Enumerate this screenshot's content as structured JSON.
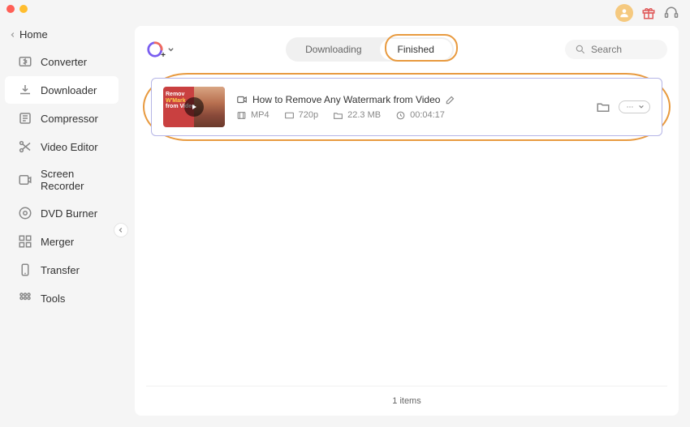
{
  "sidebar": {
    "home": "Home",
    "items": [
      {
        "label": "Converter",
        "icon": "converter"
      },
      {
        "label": "Downloader",
        "icon": "downloader",
        "active": true
      },
      {
        "label": "Compressor",
        "icon": "compressor"
      },
      {
        "label": "Video Editor",
        "icon": "editor"
      },
      {
        "label": "Screen Recorder",
        "icon": "recorder"
      },
      {
        "label": "DVD Burner",
        "icon": "dvd"
      },
      {
        "label": "Merger",
        "icon": "merger"
      },
      {
        "label": "Transfer",
        "icon": "transfer"
      },
      {
        "label": "Tools",
        "icon": "tools"
      }
    ]
  },
  "tabs": {
    "downloading": "Downloading",
    "finished": "Finished"
  },
  "search": {
    "placeholder": "Search"
  },
  "item": {
    "title": "How to Remove Any Watermark from Video",
    "format": "MP4",
    "resolution": "720p",
    "size": "22.3 MB",
    "duration": "00:04:17",
    "thumb_line1": "Remov",
    "thumb_line2": "W'Mark",
    "thumb_line3": "from Video"
  },
  "footer": "1 items"
}
